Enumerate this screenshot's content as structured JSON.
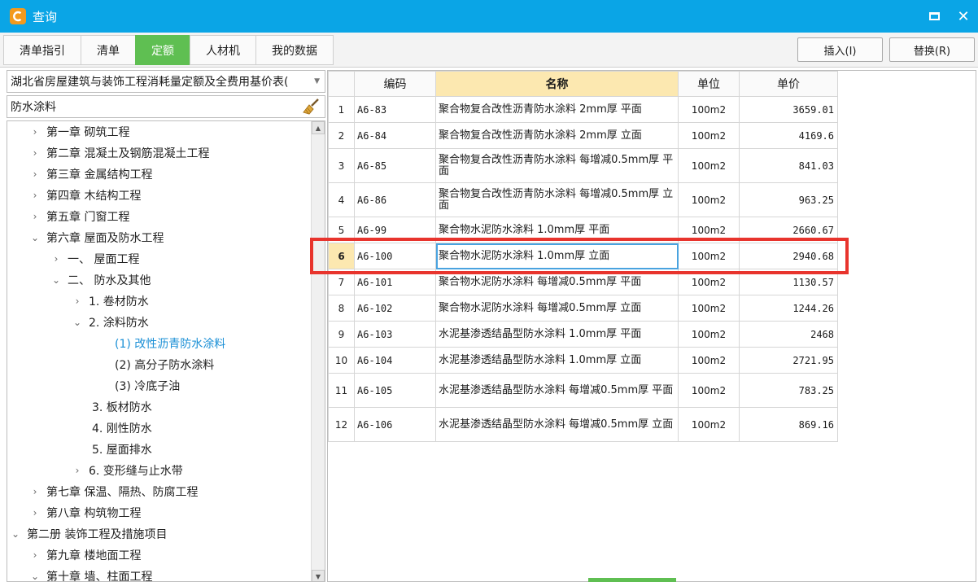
{
  "window": {
    "title": "查询",
    "accent": "#0aa5e6",
    "controls": [
      "maximize-icon",
      "close-icon"
    ]
  },
  "tabs": [
    {
      "label": "清单指引",
      "active": false
    },
    {
      "label": "清单",
      "active": false
    },
    {
      "label": "定额",
      "active": true
    },
    {
      "label": "人材机",
      "active": false
    },
    {
      "label": "我的数据",
      "active": false
    }
  ],
  "actions": {
    "insert": "插入(I)",
    "replace": "替换(R)"
  },
  "library_select": "湖北省房屋建筑与装饰工程消耗量定额及全费用基价表(",
  "search": {
    "value": "防水涂料",
    "icon": "broom-icon"
  },
  "tree": [
    {
      "label": "第一章 砌筑工程",
      "expanded": false,
      "level": 1
    },
    {
      "label": "第二章 混凝土及钢筋混凝土工程",
      "expanded": false,
      "level": 1
    },
    {
      "label": "第三章 金属结构工程",
      "expanded": false,
      "level": 1
    },
    {
      "label": "第四章 木结构工程",
      "expanded": false,
      "level": 1
    },
    {
      "label": "第五章 门窗工程",
      "expanded": false,
      "level": 1
    },
    {
      "label": "第六章 屋面及防水工程",
      "expanded": true,
      "level": 1
    },
    {
      "label": "一、 屋面工程",
      "expanded": false,
      "level": 2
    },
    {
      "label": "二、 防水及其他",
      "expanded": true,
      "level": 2
    },
    {
      "label": "1. 卷材防水",
      "expanded": false,
      "level": 3
    },
    {
      "label": "2. 涂料防水",
      "expanded": true,
      "level": 3
    },
    {
      "label": "(1) 改性沥青防水涂料",
      "selected": true,
      "level": 4
    },
    {
      "label": "(2) 高分子防水涂料",
      "level": 4
    },
    {
      "label": "(3) 冷底子油",
      "level": 4
    },
    {
      "label": "3. 板材防水",
      "level": 3
    },
    {
      "label": "4. 刚性防水",
      "level": 3
    },
    {
      "label": "5. 屋面排水",
      "level": 3
    },
    {
      "label": "6. 变形缝与止水带",
      "expanded": false,
      "level": 3
    },
    {
      "label": "第七章 保温、隔热、防腐工程",
      "expanded": false,
      "level": 1
    },
    {
      "label": "第八章 构筑物工程",
      "expanded": false,
      "level": 1
    },
    {
      "label": "第二册 装饰工程及措施项目",
      "expanded": true,
      "level": 0
    },
    {
      "label": "第九章 楼地面工程",
      "expanded": false,
      "level": 1
    },
    {
      "label": "第十章 墙、柱面工程",
      "expanded": true,
      "level": 1
    }
  ],
  "grid": {
    "headers": {
      "code": "编码",
      "name": "名称",
      "unit": "单位",
      "price": "单价"
    },
    "rows": [
      {
        "no": "1",
        "code": "A6-83",
        "name": "聚合物复合改性沥青防水涂料 2mm厚 平面",
        "unit": "100m2",
        "price": "3659.01"
      },
      {
        "no": "2",
        "code": "A6-84",
        "name": "聚合物复合改性沥青防水涂料 2mm厚 立面",
        "unit": "100m2",
        "price": "4169.6"
      },
      {
        "no": "3",
        "code": "A6-85",
        "name": "聚合物复合改性沥青防水涂料 每增减0.5mm厚 平面",
        "unit": "100m2",
        "price": "841.03"
      },
      {
        "no": "4",
        "code": "A6-86",
        "name": "聚合物复合改性沥青防水涂料 每增减0.5mm厚 立面",
        "unit": "100m2",
        "price": "963.25"
      },
      {
        "no": "5",
        "code": "A6-99",
        "name": "聚合物水泥防水涂料 1.0mm厚 平面",
        "unit": "100m2",
        "price": "2660.67"
      },
      {
        "no": "6",
        "code": "A6-100",
        "name": "聚合物水泥防水涂料 1.0mm厚 立面",
        "unit": "100m2",
        "price": "2940.68",
        "selected": true
      },
      {
        "no": "7",
        "code": "A6-101",
        "name": "聚合物水泥防水涂料 每增减0.5mm厚 平面",
        "unit": "100m2",
        "price": "1130.57"
      },
      {
        "no": "8",
        "code": "A6-102",
        "name": "聚合物水泥防水涂料 每增减0.5mm厚 立面",
        "unit": "100m2",
        "price": "1244.26"
      },
      {
        "no": "9",
        "code": "A6-103",
        "name": "水泥基渗透结晶型防水涂料 1.0mm厚 平面",
        "unit": "100m2",
        "price": "2468"
      },
      {
        "no": "10",
        "code": "A6-104",
        "name": "水泥基渗透结晶型防水涂料 1.0mm厚 立面",
        "unit": "100m2",
        "price": "2721.95"
      },
      {
        "no": "11",
        "code": "A6-105",
        "name": "水泥基渗透结晶型防水涂料 每增减0.5mm厚 平面",
        "unit": "100m2",
        "price": "783.25"
      },
      {
        "no": "12",
        "code": "A6-106",
        "name": "水泥基渗透结晶型防水涂料 每增减0.5mm厚 立面",
        "unit": "100m2",
        "price": "869.16"
      }
    ]
  }
}
